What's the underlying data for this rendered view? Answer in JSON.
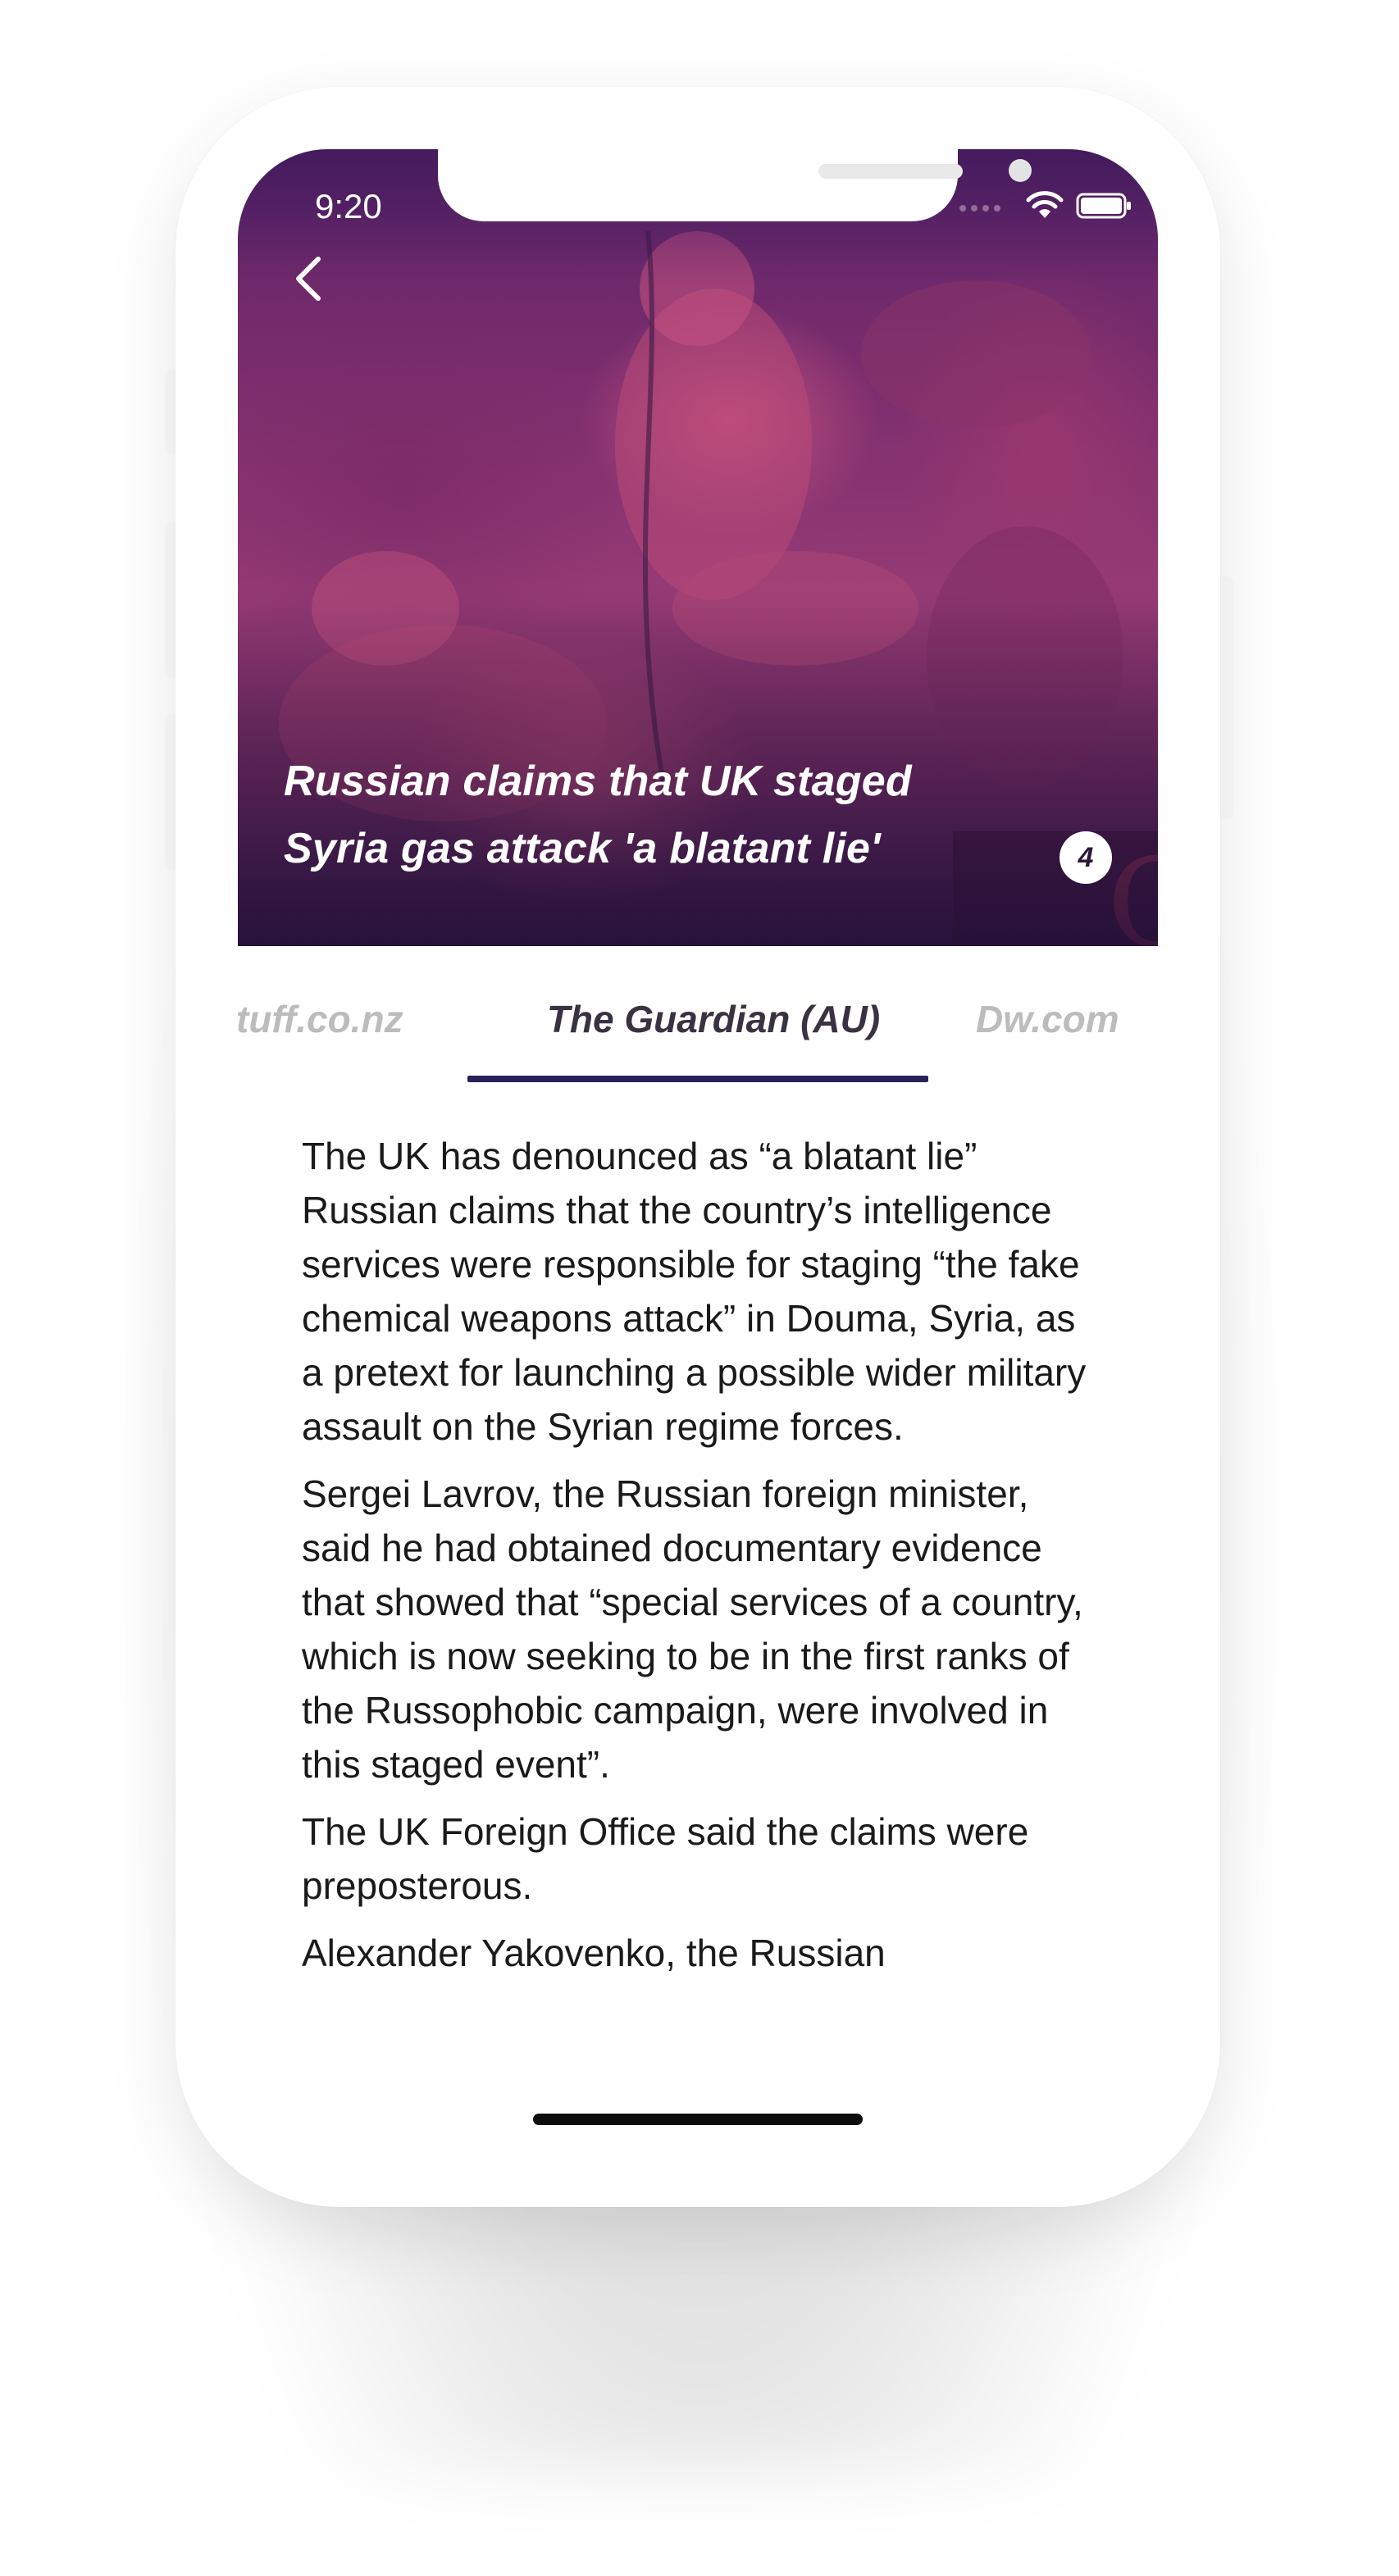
{
  "status_bar": {
    "time": "9:20"
  },
  "hero": {
    "title": "Russian claims that UK staged Syria gas attack 'a blatant lie'",
    "badge_count": "4"
  },
  "tabs": [
    {
      "label": "tuff.co.nz",
      "active": false
    },
    {
      "label": "The Guardian (AU)",
      "active": true
    },
    {
      "label": "Dw.com",
      "active": false
    }
  ],
  "article": {
    "paragraphs": [
      "The UK has denounced as “a blatant lie” Russian claims that the country’s intelligence services were responsible for staging “the fake chemical weapons attack” in Douma, Syria, as a pretext for launching a possible wider military assault on the Syrian regime forces.",
      "Sergei Lavrov, the Russian foreign minister, said he had obtained documentary evidence that showed that “special services of a country, which is now seeking to be in the first ranks of the Russophobic campaign, were involved in this staged event”.",
      "The UK Foreign Office said the claims were preposterous.",
      "Alexander Yakovenko, the Russian"
    ]
  },
  "colors": {
    "tab_underline": "#282258",
    "hero_tint": "#7d2e6e",
    "active_tab_text": "#393241",
    "inactive_tab_text": "#bcbcbc"
  },
  "icons": [
    "back-chevron-icon",
    "signal-icon",
    "wifi-icon",
    "battery-icon"
  ]
}
